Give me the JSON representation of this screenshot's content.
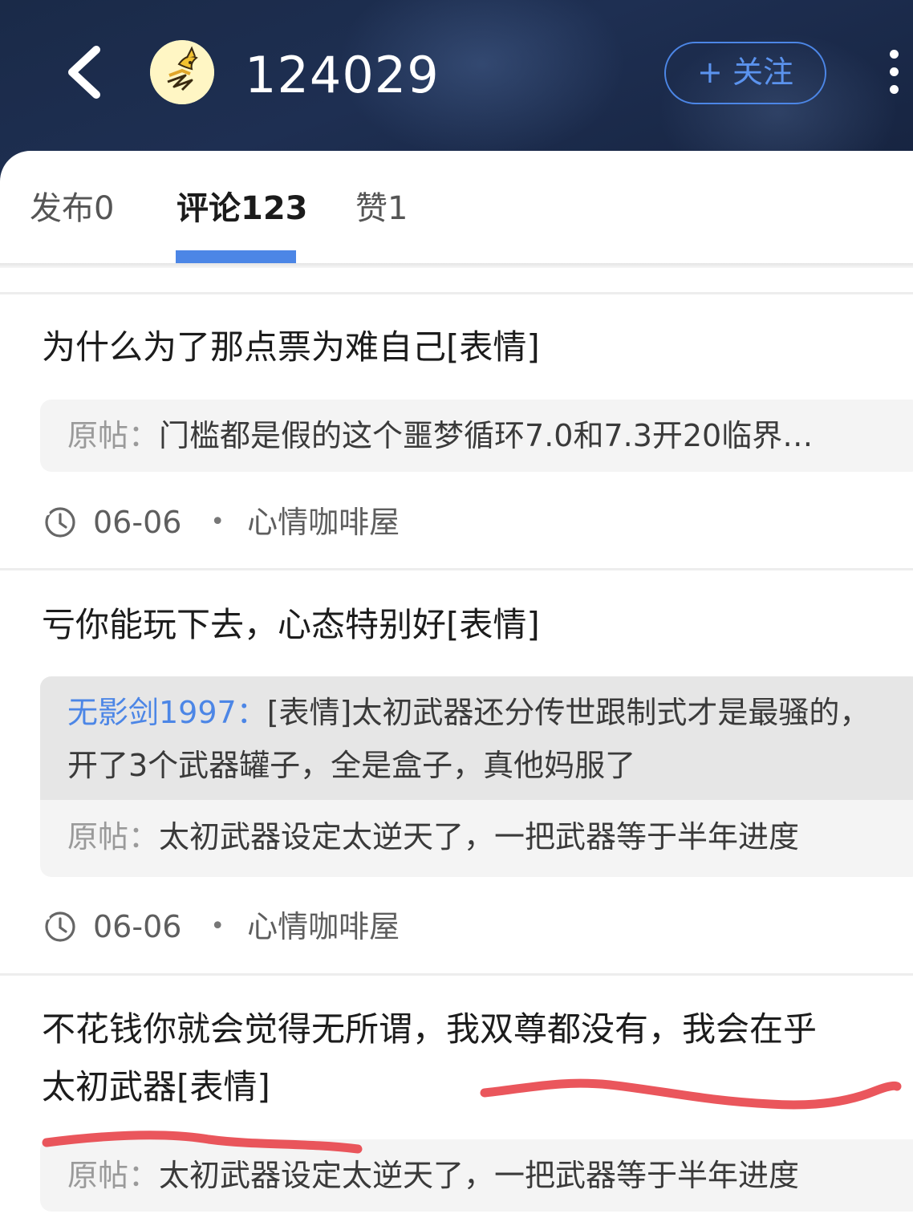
{
  "header": {
    "username": "124029",
    "follow_label": "+ 关注",
    "back_icon": "chevron-left-icon",
    "more_icon": "more-vertical-icon"
  },
  "tabs": [
    {
      "label": "发布0",
      "active": false
    },
    {
      "label": "评论123",
      "active": true
    },
    {
      "label": "赞1",
      "active": false
    }
  ],
  "comments": [
    {
      "text": "为什么为了那点票为难自己[表情]",
      "quote_label": "原帖：",
      "quote_text": "门槛都是假的这个噩梦循环7.0和7.3开20临界…",
      "date": "06-06",
      "board": "心情咖啡屋"
    },
    {
      "text": "亏你能玩下去，心态特别好[表情]",
      "reply_user": "无影剑1997：",
      "reply_text": "[表情]太初武器还分传世跟制式才是最骚的，开了3个武器罐子，全是盒子，真他妈服了",
      "quote_label": "原帖：",
      "quote_text": "太初武器设定太逆天了，一把武器等于半年进度",
      "date": "06-06",
      "board": "心情咖啡屋"
    },
    {
      "text_line1": "不花钱你就会觉得无所谓，我双尊都没有，我会在乎",
      "text_line2": "太初武器[表情]",
      "quote_label": "原帖：",
      "quote_text": "太初武器设定太逆天了，一把武器等于半年进度"
    }
  ],
  "colors": {
    "accent": "#4c86e6",
    "header_bg": "#1c2c4c",
    "annotation": "#e8444a"
  }
}
